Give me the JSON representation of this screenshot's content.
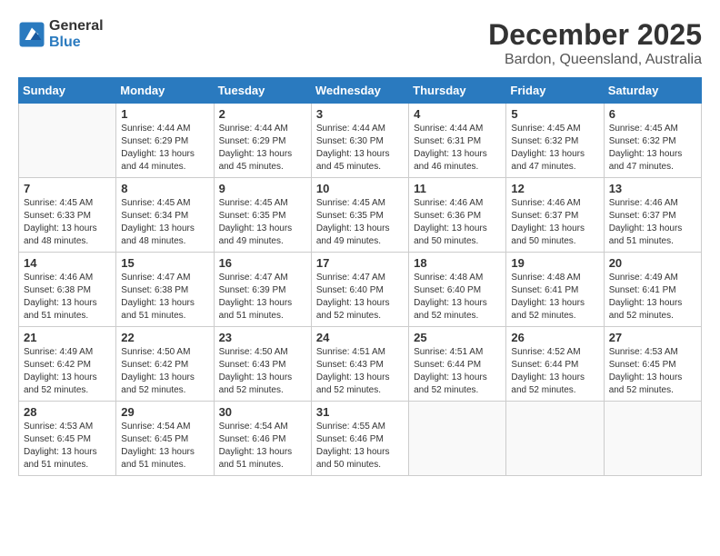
{
  "header": {
    "logo_line1": "General",
    "logo_line2": "Blue",
    "month_title": "December 2025",
    "location": "Bardon, Queensland, Australia"
  },
  "days_of_week": [
    "Sunday",
    "Monday",
    "Tuesday",
    "Wednesday",
    "Thursday",
    "Friday",
    "Saturday"
  ],
  "weeks": [
    [
      {
        "day": "",
        "sunrise": "",
        "sunset": "",
        "daylight": ""
      },
      {
        "day": "1",
        "sunrise": "Sunrise: 4:44 AM",
        "sunset": "Sunset: 6:29 PM",
        "daylight": "Daylight: 13 hours and 44 minutes."
      },
      {
        "day": "2",
        "sunrise": "Sunrise: 4:44 AM",
        "sunset": "Sunset: 6:29 PM",
        "daylight": "Daylight: 13 hours and 45 minutes."
      },
      {
        "day": "3",
        "sunrise": "Sunrise: 4:44 AM",
        "sunset": "Sunset: 6:30 PM",
        "daylight": "Daylight: 13 hours and 45 minutes."
      },
      {
        "day": "4",
        "sunrise": "Sunrise: 4:44 AM",
        "sunset": "Sunset: 6:31 PM",
        "daylight": "Daylight: 13 hours and 46 minutes."
      },
      {
        "day": "5",
        "sunrise": "Sunrise: 4:45 AM",
        "sunset": "Sunset: 6:32 PM",
        "daylight": "Daylight: 13 hours and 47 minutes."
      },
      {
        "day": "6",
        "sunrise": "Sunrise: 4:45 AM",
        "sunset": "Sunset: 6:32 PM",
        "daylight": "Daylight: 13 hours and 47 minutes."
      }
    ],
    [
      {
        "day": "7",
        "sunrise": "Sunrise: 4:45 AM",
        "sunset": "Sunset: 6:33 PM",
        "daylight": "Daylight: 13 hours and 48 minutes."
      },
      {
        "day": "8",
        "sunrise": "Sunrise: 4:45 AM",
        "sunset": "Sunset: 6:34 PM",
        "daylight": "Daylight: 13 hours and 48 minutes."
      },
      {
        "day": "9",
        "sunrise": "Sunrise: 4:45 AM",
        "sunset": "Sunset: 6:35 PM",
        "daylight": "Daylight: 13 hours and 49 minutes."
      },
      {
        "day": "10",
        "sunrise": "Sunrise: 4:45 AM",
        "sunset": "Sunset: 6:35 PM",
        "daylight": "Daylight: 13 hours and 49 minutes."
      },
      {
        "day": "11",
        "sunrise": "Sunrise: 4:46 AM",
        "sunset": "Sunset: 6:36 PM",
        "daylight": "Daylight: 13 hours and 50 minutes."
      },
      {
        "day": "12",
        "sunrise": "Sunrise: 4:46 AM",
        "sunset": "Sunset: 6:37 PM",
        "daylight": "Daylight: 13 hours and 50 minutes."
      },
      {
        "day": "13",
        "sunrise": "Sunrise: 4:46 AM",
        "sunset": "Sunset: 6:37 PM",
        "daylight": "Daylight: 13 hours and 51 minutes."
      }
    ],
    [
      {
        "day": "14",
        "sunrise": "Sunrise: 4:46 AM",
        "sunset": "Sunset: 6:38 PM",
        "daylight": "Daylight: 13 hours and 51 minutes."
      },
      {
        "day": "15",
        "sunrise": "Sunrise: 4:47 AM",
        "sunset": "Sunset: 6:38 PM",
        "daylight": "Daylight: 13 hours and 51 minutes."
      },
      {
        "day": "16",
        "sunrise": "Sunrise: 4:47 AM",
        "sunset": "Sunset: 6:39 PM",
        "daylight": "Daylight: 13 hours and 51 minutes."
      },
      {
        "day": "17",
        "sunrise": "Sunrise: 4:47 AM",
        "sunset": "Sunset: 6:40 PM",
        "daylight": "Daylight: 13 hours and 52 minutes."
      },
      {
        "day": "18",
        "sunrise": "Sunrise: 4:48 AM",
        "sunset": "Sunset: 6:40 PM",
        "daylight": "Daylight: 13 hours and 52 minutes."
      },
      {
        "day": "19",
        "sunrise": "Sunrise: 4:48 AM",
        "sunset": "Sunset: 6:41 PM",
        "daylight": "Daylight: 13 hours and 52 minutes."
      },
      {
        "day": "20",
        "sunrise": "Sunrise: 4:49 AM",
        "sunset": "Sunset: 6:41 PM",
        "daylight": "Daylight: 13 hours and 52 minutes."
      }
    ],
    [
      {
        "day": "21",
        "sunrise": "Sunrise: 4:49 AM",
        "sunset": "Sunset: 6:42 PM",
        "daylight": "Daylight: 13 hours and 52 minutes."
      },
      {
        "day": "22",
        "sunrise": "Sunrise: 4:50 AM",
        "sunset": "Sunset: 6:42 PM",
        "daylight": "Daylight: 13 hours and 52 minutes."
      },
      {
        "day": "23",
        "sunrise": "Sunrise: 4:50 AM",
        "sunset": "Sunset: 6:43 PM",
        "daylight": "Daylight: 13 hours and 52 minutes."
      },
      {
        "day": "24",
        "sunrise": "Sunrise: 4:51 AM",
        "sunset": "Sunset: 6:43 PM",
        "daylight": "Daylight: 13 hours and 52 minutes."
      },
      {
        "day": "25",
        "sunrise": "Sunrise: 4:51 AM",
        "sunset": "Sunset: 6:44 PM",
        "daylight": "Daylight: 13 hours and 52 minutes."
      },
      {
        "day": "26",
        "sunrise": "Sunrise: 4:52 AM",
        "sunset": "Sunset: 6:44 PM",
        "daylight": "Daylight: 13 hours and 52 minutes."
      },
      {
        "day": "27",
        "sunrise": "Sunrise: 4:53 AM",
        "sunset": "Sunset: 6:45 PM",
        "daylight": "Daylight: 13 hours and 52 minutes."
      }
    ],
    [
      {
        "day": "28",
        "sunrise": "Sunrise: 4:53 AM",
        "sunset": "Sunset: 6:45 PM",
        "daylight": "Daylight: 13 hours and 51 minutes."
      },
      {
        "day": "29",
        "sunrise": "Sunrise: 4:54 AM",
        "sunset": "Sunset: 6:45 PM",
        "daylight": "Daylight: 13 hours and 51 minutes."
      },
      {
        "day": "30",
        "sunrise": "Sunrise: 4:54 AM",
        "sunset": "Sunset: 6:46 PM",
        "daylight": "Daylight: 13 hours and 51 minutes."
      },
      {
        "day": "31",
        "sunrise": "Sunrise: 4:55 AM",
        "sunset": "Sunset: 6:46 PM",
        "daylight": "Daylight: 13 hours and 50 minutes."
      },
      {
        "day": "",
        "sunrise": "",
        "sunset": "",
        "daylight": ""
      },
      {
        "day": "",
        "sunrise": "",
        "sunset": "",
        "daylight": ""
      },
      {
        "day": "",
        "sunrise": "",
        "sunset": "",
        "daylight": ""
      }
    ]
  ]
}
